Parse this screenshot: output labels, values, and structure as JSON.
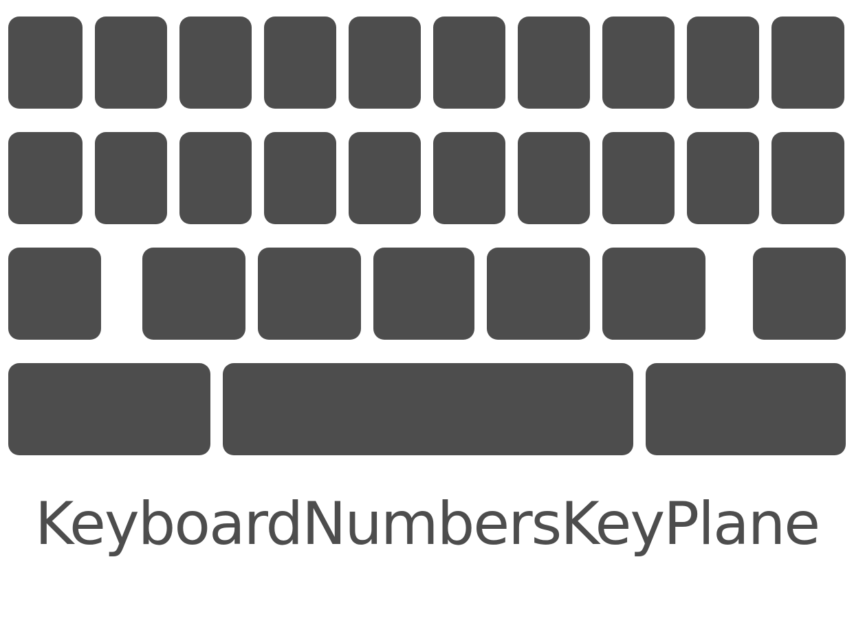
{
  "caption": "KeyboardNumbersKeyPlane",
  "colors": {
    "key": "#4d4d4d",
    "background": "#ffffff",
    "caption": "#4d4d4d"
  }
}
